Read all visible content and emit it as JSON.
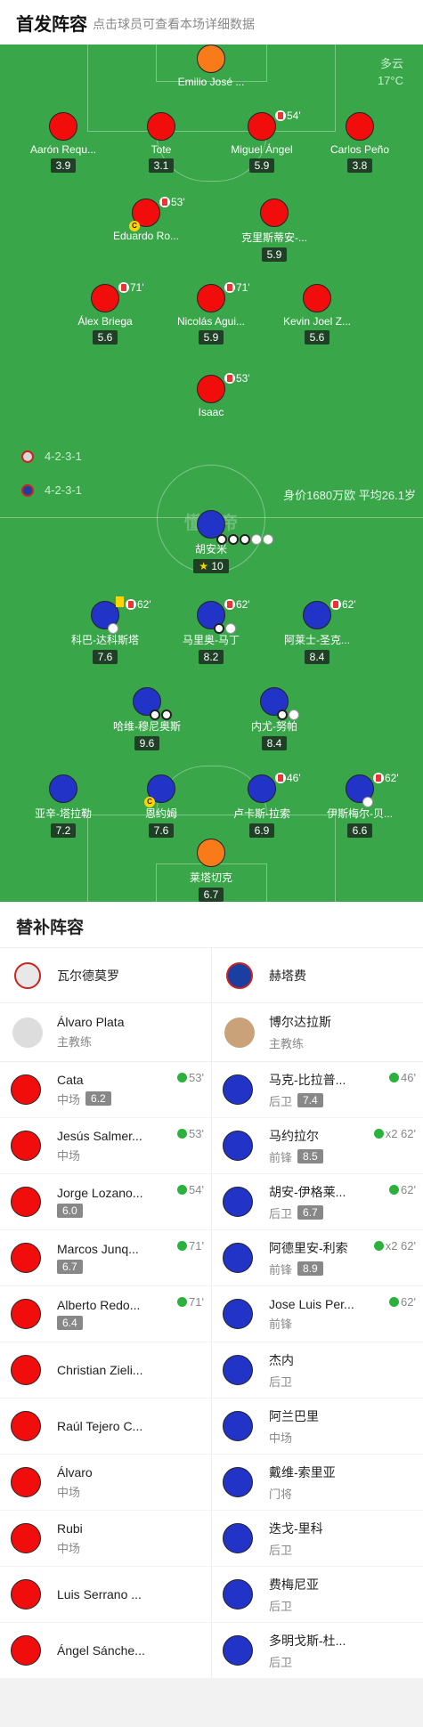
{
  "header": {
    "title": "首发阵容",
    "subtitle": "点击球员可查看本场详细数据"
  },
  "weather": {
    "condition": "多云",
    "temp": "17°C"
  },
  "home_formation": "4-2-3-1",
  "away_formation": "4-2-3-1",
  "watermark": "懂球帝",
  "valuation": "身价1680万欧 平均26.1岁",
  "home_players": {
    "gk": {
      "name": "Emilio José ..."
    },
    "d1": {
      "name": "Aarón Requ...",
      "rating": "3.9"
    },
    "d2": {
      "name": "Tote",
      "rating": "3.1"
    },
    "d3": {
      "name": "Miguel Ángel",
      "rating": "5.9",
      "event": "54'"
    },
    "d4": {
      "name": "Carlos Peño",
      "rating": "3.8"
    },
    "m1": {
      "name": "Eduardo Ro...",
      "event": "53'"
    },
    "m2": {
      "name": "克里斯蒂安-...",
      "rating": "5.9"
    },
    "a1": {
      "name": "Álex Briega",
      "rating": "5.6",
      "event": "71'"
    },
    "a2": {
      "name": "Nicolás Agui...",
      "rating": "5.9",
      "event": "71'"
    },
    "a3": {
      "name": "Kevin Joel Z...",
      "rating": "5.6"
    },
    "st": {
      "name": "Isaac",
      "event": "53'"
    }
  },
  "away_players": {
    "st": {
      "name": "胡安米",
      "rating": "10"
    },
    "a1": {
      "name": "科巴-达科斯塔",
      "rating": "7.6",
      "event": "62'"
    },
    "a2": {
      "name": "马里奥-马丁",
      "rating": "8.2",
      "event": "62'"
    },
    "a3": {
      "name": "阿莱士-圣克...",
      "rating": "8.4",
      "event": "62'"
    },
    "m1": {
      "name": "哈维-穆尼奥斯",
      "rating": "9.6"
    },
    "m2": {
      "name": "内尤-努帕",
      "rating": "8.4"
    },
    "d1": {
      "name": "亚辛-塔拉勒",
      "rating": "7.2"
    },
    "d2": {
      "name": "恩约姆",
      "rating": "7.6"
    },
    "d3": {
      "name": "卢卡斯-拉索",
      "rating": "6.9",
      "event": "46'"
    },
    "d4": {
      "name": "伊斯梅尔-贝...",
      "rating": "6.6",
      "event": "62'"
    },
    "gk": {
      "name": "莱塔切克",
      "rating": "6.7"
    }
  },
  "subs": {
    "title": "替补阵容",
    "home": {
      "team": "瓦尔德莫罗",
      "coach": {
        "name": "Álvaro Plata",
        "role": "主教练"
      },
      "players": [
        {
          "name": "Cata",
          "pos": "中场",
          "rating": "6.2",
          "event": "53'"
        },
        {
          "name": "Jesús Salmer...",
          "pos": "中场",
          "rating": "",
          "event": "53'"
        },
        {
          "name": "Jorge Lozano...",
          "pos": "",
          "rating": "6.0",
          "event": "54'"
        },
        {
          "name": "Marcos Junq...",
          "pos": "",
          "rating": "6.7",
          "event": "71'"
        },
        {
          "name": "Alberto Redo...",
          "pos": "",
          "rating": "6.4",
          "event": "71'"
        },
        {
          "name": "Christian Zieli...",
          "pos": "",
          "rating": "",
          "event": ""
        },
        {
          "name": "Raúl Tejero C...",
          "pos": "",
          "rating": "",
          "event": ""
        },
        {
          "name": "Álvaro",
          "pos": "中场",
          "rating": "",
          "event": ""
        },
        {
          "name": "Rubi",
          "pos": "中场",
          "rating": "",
          "event": ""
        },
        {
          "name": "Luis Serrano ...",
          "pos": "",
          "rating": "",
          "event": ""
        },
        {
          "name": "Ángel Sánche...",
          "pos": "",
          "rating": "",
          "event": ""
        }
      ]
    },
    "away": {
      "team": "赫塔费",
      "coach": {
        "name": "博尔达拉斯",
        "role": "主教练"
      },
      "players": [
        {
          "name": "马克-比拉普...",
          "pos": "后卫",
          "rating": "7.4",
          "event": "46'"
        },
        {
          "name": "马约拉尔",
          "pos": "前锋",
          "rating": "8.5",
          "event": "x2 62'"
        },
        {
          "name": "胡安-伊格莱...",
          "pos": "后卫",
          "rating": "6.7",
          "event": "62'"
        },
        {
          "name": "阿德里安-利索",
          "pos": "前锋",
          "rating": "8.9",
          "event": "x2 62'"
        },
        {
          "name": "Jose Luis Per...",
          "pos": "前锋",
          "rating": "",
          "event": "62'"
        },
        {
          "name": "杰内",
          "pos": "后卫",
          "rating": "",
          "event": ""
        },
        {
          "name": "阿兰巴里",
          "pos": "中场",
          "rating": "",
          "event": ""
        },
        {
          "name": "戴维-索里亚",
          "pos": "门将",
          "rating": "",
          "event": ""
        },
        {
          "name": "迭戈-里科",
          "pos": "后卫",
          "rating": "",
          "event": ""
        },
        {
          "name": "费梅尼亚",
          "pos": "后卫",
          "rating": "",
          "event": ""
        },
        {
          "name": "多明戈斯-杜...",
          "pos": "后卫",
          "rating": "",
          "event": ""
        }
      ]
    }
  }
}
